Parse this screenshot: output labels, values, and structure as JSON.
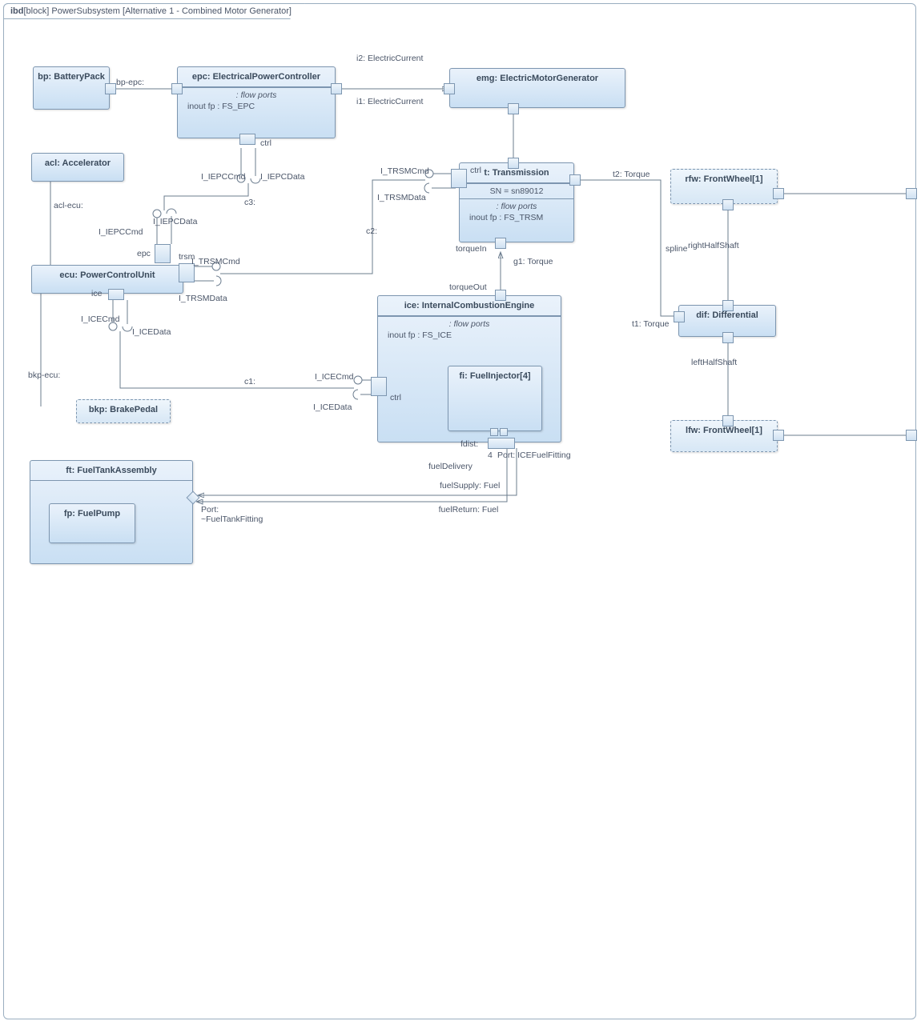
{
  "frame": {
    "kind": "ibd",
    "kindBracket": "[block]",
    "name": "PowerSubsystem",
    "alt": "[Alternative 1 - Combined Motor Generator]"
  },
  "blocks": {
    "bp": {
      "label": "bp: BatteryPack"
    },
    "epc": {
      "label": "epc: ElectricalPowerController",
      "flowHeading": ": flow ports",
      "flowLine": "inout fp : FS_EPC"
    },
    "emg": {
      "label": "emg: ElectricMotorGenerator"
    },
    "acl": {
      "label": "acl: Accelerator"
    },
    "ecu": {
      "label": "ecu: PowerControlUnit"
    },
    "bkp": {
      "label": "bkp: BrakePedal"
    },
    "t": {
      "label": "t: Transmission",
      "sn": "SN = sn89012",
      "flowHeading": ": flow ports",
      "flowLine": "inout fp : FS_TRSM"
    },
    "ice": {
      "label": "ice: InternalCombustionEngine",
      "flowHeading": ": flow ports",
      "flowLine": "inout fp : FS_ICE"
    },
    "fi": {
      "label": "fi: FuelInjector[4]"
    },
    "ft": {
      "label": "ft: FuelTankAssembly"
    },
    "fp": {
      "label": "fp: FuelPump"
    },
    "rfw": {
      "label": "rfw: FrontWheel[1]"
    },
    "dif": {
      "label": "dif: Differential"
    },
    "lfw": {
      "label": "lfw: FrontWheel[1]"
    }
  },
  "ports": {
    "epc_ctrl": "ctrl",
    "ecu_epc": "epc",
    "ecu_trsm": "trsm",
    "ecu_ice": "ice",
    "t_ctrl": "ctrl",
    "t_torqueIn": "torqueIn",
    "ice_torqueOut": "torqueOut",
    "ice_ctrl": "ctrl",
    "ice_fdist": "fdist:",
    "ice_port": "Port: ICEFuelFitting",
    "ice_mult": "4",
    "ft_port": "Port: ~FuelTankFitting"
  },
  "interfaces": {
    "iepc_cmd": "I_IEPCCmd",
    "iepc_data": "I_IEPCData",
    "trsm_cmd": "I_TRSMCmd",
    "trsm_data": "I_TRSMData",
    "ice_cmd": "I_ICECmd",
    "ice_data": "I_ICEData"
  },
  "connectors": {
    "bp_epc": "bp-epc:",
    "acl_ecu": "acl-ecu:",
    "bkp_ecu": "bkp-ecu:",
    "c1": "c1:",
    "c2": "c2:",
    "c3": "c3:",
    "i1": "i1: ElectricCurrent",
    "i2": "i2: ElectricCurrent",
    "g1": "g1: Torque",
    "t1": "t1: Torque",
    "t2": "t2: Torque",
    "spline": "spline",
    "rightHalfShaft": "rightHalfShaft",
    "leftHalfShaft": "leftHalfShaft",
    "fuelDelivery": "fuelDelivery",
    "fuelSupply": "fuelSupply: Fuel",
    "fuelReturn": "fuelReturn: Fuel"
  }
}
